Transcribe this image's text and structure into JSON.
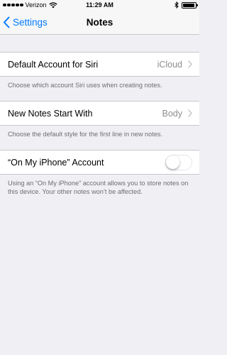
{
  "status_bar": {
    "carrier": "Verizon",
    "time": "11:29 AM",
    "signal_dots": 5
  },
  "nav": {
    "back_label": "Settings",
    "title": "Notes"
  },
  "sections": {
    "default_account": {
      "label": "Default Account for Siri",
      "value": "iCloud",
      "footer": "Choose which account Siri uses when creating notes."
    },
    "new_notes": {
      "label": "New Notes Start With",
      "value": "Body",
      "footer": "Choose the default style for the first line in new notes."
    },
    "on_my_iphone": {
      "label": "“On My iPhone” Account",
      "toggle_on": false,
      "footer": "Using an “On My iPhone” account allows you to store notes on this device. Your other notes won’t be affected."
    }
  },
  "colors": {
    "accent": "#007aff",
    "background": "#efeff4",
    "secondary_text": "#8e8e93"
  }
}
